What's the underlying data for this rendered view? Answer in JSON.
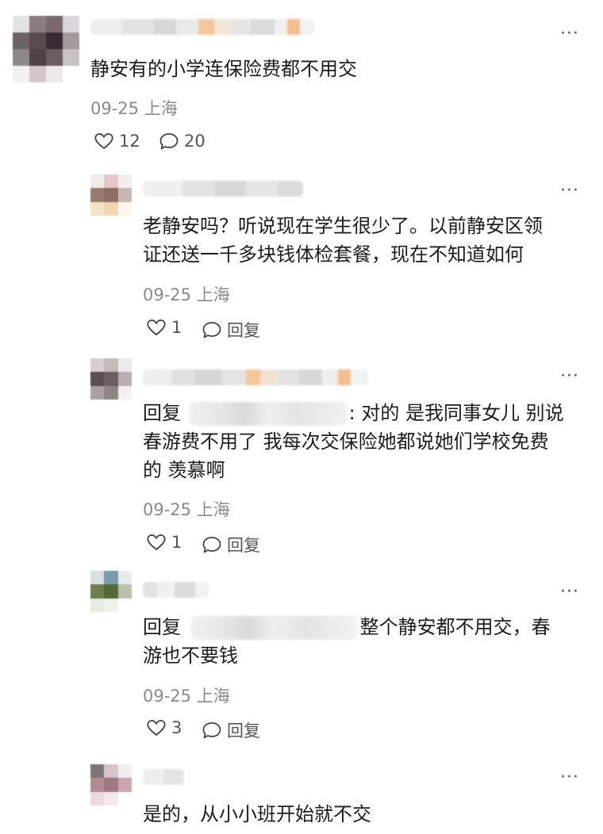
{
  "thread": {
    "root": {
      "text": "静安有的小学连保险费都不用交",
      "date": "09-25",
      "location": "上海",
      "likes": "12",
      "comments": "20",
      "more": "···"
    },
    "replies": [
      {
        "text_lines": [
          "老静安吗？听说现在学生很少了。以前静安区领",
          "证还送一千多块钱体检套餐，现在不知道如何"
        ],
        "date": "09-25",
        "location": "上海",
        "likes": "1",
        "reply_label": "回复",
        "more": "···"
      },
      {
        "reply_prefix": "回复",
        "line1_suffix": ": 对的 是我同事女儿 别说",
        "text_lines": [
          "春游费不用了 我每次交保险她都说她们学校免费",
          "的 羡慕啊"
        ],
        "date": "09-25",
        "location": "上海",
        "likes": "1",
        "reply_label": "回复",
        "more": "···"
      },
      {
        "reply_prefix": "回复",
        "line1_suffix": "整个静安都不用交，春",
        "text_lines": [
          "游也不要钱"
        ],
        "date": "09-25",
        "location": "上海",
        "likes": "3",
        "reply_label": "回复",
        "more": "···"
      },
      {
        "text_lines": [
          "是的，从小小班开始就不交"
        ],
        "more": "···"
      }
    ]
  },
  "icons": {
    "like": "heart-outline-icon",
    "comment": "speech-bubble-icon",
    "more": "ellipsis-icon"
  }
}
